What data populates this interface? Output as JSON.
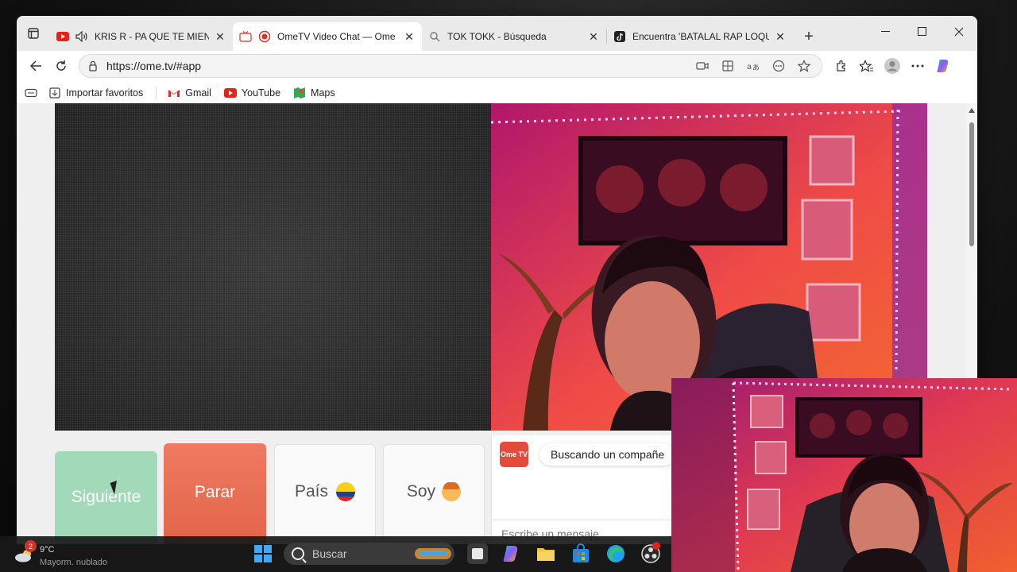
{
  "tabs": [
    {
      "title": "KRIS R - PA QUE TE MIENTO",
      "favicon": "youtube-icon",
      "audio": true
    },
    {
      "title": "OmeTV Video Chat — Ome",
      "favicon": "ometv-icon",
      "active": true
    },
    {
      "title": "TOK TOKK - Búsqueda",
      "favicon": "search-icon"
    },
    {
      "title": "Encuentra 'BATALAL RAP LOQUI",
      "favicon": "tiktok-icon"
    }
  ],
  "address": {
    "url": "https://ome.tv/#app"
  },
  "favorites": [
    {
      "label": "Importar favoritos",
      "icon": "import-icon"
    },
    {
      "label": "Gmail",
      "icon": "gmail-icon"
    },
    {
      "label": "YouTube",
      "icon": "youtube-icon"
    },
    {
      "label": "Maps",
      "icon": "maps-icon"
    }
  ],
  "controls": {
    "next_label": "Siguiente",
    "stop_label": "Parar",
    "country_label": "País",
    "gender_label": "Soy"
  },
  "chat": {
    "logo_text": "Ome TV",
    "status_message": "Buscando un compañe",
    "input_placeholder": "Escribe un mensaje"
  },
  "taskbar": {
    "weather_badge": "2",
    "temperature": "9°C",
    "condition": "Mayorm. nublado",
    "search_placeholder": "Buscar"
  },
  "colors": {
    "next_button": "#a2d9b8",
    "stop_button": "#e2654a",
    "ometv_brand": "#e44b3a"
  }
}
